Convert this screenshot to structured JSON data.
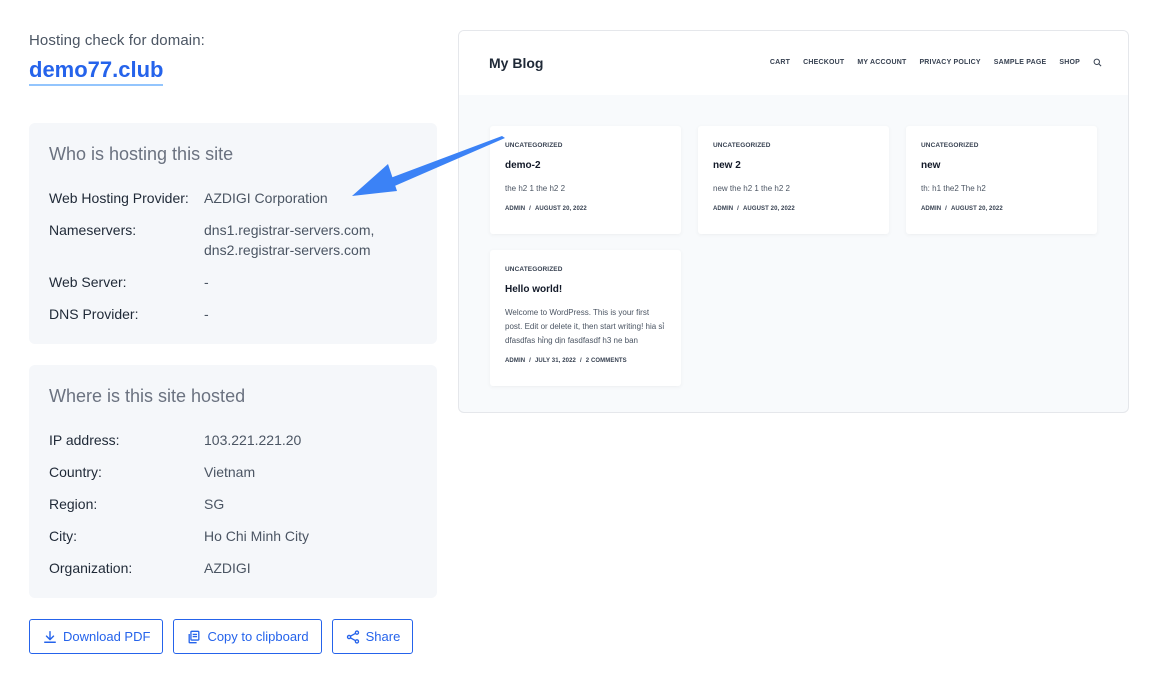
{
  "header": {
    "subtitle": "Hosting check for domain:",
    "domain": "demo77.club"
  },
  "who": {
    "title": "Who is hosting this site",
    "rows": [
      {
        "label": "Web Hosting Provider:",
        "value": "AZDIGI Corporation"
      },
      {
        "label": "Nameservers:",
        "value": "dns1.registrar-servers.com,",
        "value2": "dns2.registrar-servers.com"
      },
      {
        "label": "Web Server:",
        "value": "-"
      },
      {
        "label": "DNS Provider:",
        "value": "-"
      }
    ]
  },
  "where": {
    "title": "Where is this site hosted",
    "rows": [
      {
        "label": "IP address:",
        "value": "103.221.221.20"
      },
      {
        "label": "Country:",
        "value": "Vietnam"
      },
      {
        "label": "Region:",
        "value": "SG"
      },
      {
        "label": "City:",
        "value": "Ho Chi Minh City"
      },
      {
        "label": "Organization:",
        "value": "AZDIGI"
      }
    ]
  },
  "actions": {
    "download": "Download PDF",
    "copy": "Copy to clipboard",
    "share": "Share"
  },
  "preview": {
    "site_title": "My Blog",
    "nav": [
      "CART",
      "CHECKOUT",
      "MY ACCOUNT",
      "PRIVACY POLICY",
      "SAMPLE PAGE",
      "SHOP"
    ],
    "posts": [
      {
        "category": "UNCATEGORIZED",
        "title": "demo-2",
        "excerpt": "the h2 1 the h2 2",
        "author": "ADMIN",
        "date": "AUGUST 20, 2022",
        "comments": ""
      },
      {
        "category": "UNCATEGORIZED",
        "title": "new 2",
        "excerpt": "new the h2 1 the h2 2",
        "author": "ADMIN",
        "date": "AUGUST 20, 2022",
        "comments": ""
      },
      {
        "category": "UNCATEGORIZED",
        "title": "new",
        "excerpt": "th: h1 the2 The h2",
        "author": "ADMIN",
        "date": "AUGUST 20, 2022",
        "comments": ""
      },
      {
        "category": "UNCATEGORIZED",
        "title": "Hello world!",
        "excerpt": "Welcome to WordPress. This is your first post. Edit or delete it, then start writing! hia sỉ dfasdfas hỉng dịn fasdfasdf h3 ne ban",
        "author": "ADMIN",
        "date": "JULY 31, 2022",
        "comments": "2 COMMENTS"
      }
    ]
  },
  "colors": {
    "accent": "#2563eb",
    "panel_bg": "#f5f7fa",
    "arrow": "#3b82f6"
  },
  "icons": [
    "download-icon",
    "copy-icon",
    "share-icon",
    "search-icon",
    "arrow-pointer"
  ]
}
